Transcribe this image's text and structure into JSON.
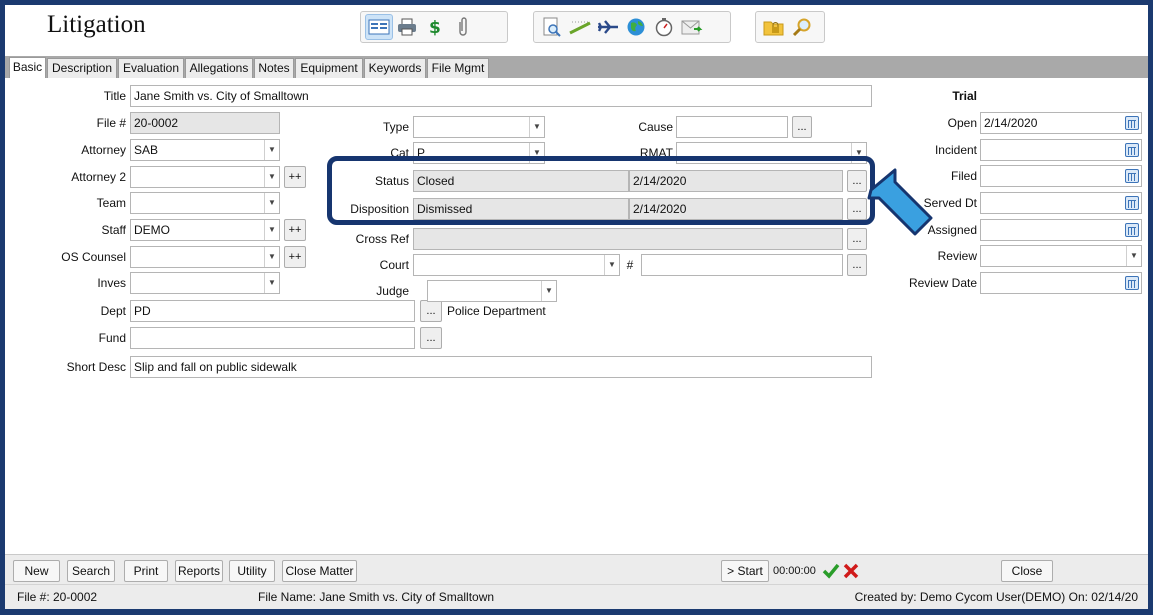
{
  "app": {
    "title": "Litigation"
  },
  "toolbar": {
    "group1": [
      "form-view-icon",
      "printer-icon",
      "money-icon",
      "paperclip-icon"
    ],
    "group2": [
      "document-search-icon",
      "pen-icon",
      "airplane-icon",
      "globe-icon",
      "stopwatch-icon",
      "email-icon"
    ],
    "group3": [
      "folder-lock-icon",
      "magnifier-icon"
    ]
  },
  "tabs": [
    "Basic",
    "Description",
    "Evaluation",
    "Allegations",
    "Notes",
    "Equipment",
    "Keywords",
    "File Mgmt"
  ],
  "form": {
    "title_label": "Title",
    "title_value": "Jane Smith vs. City of Smalltown",
    "file_label": "File #",
    "file_value": "20-0002",
    "attorney_label": "Attorney",
    "attorney_value": "SAB",
    "attorney2_label": "Attorney 2",
    "attorney2_value": "",
    "team_label": "Team",
    "team_value": "",
    "staff_label": "Staff",
    "staff_value": "DEMO",
    "os_counsel_label": "OS Counsel",
    "os_counsel_value": "",
    "inves_label": "Inves",
    "inves_value": "",
    "dept_label": "Dept",
    "dept_value": "PD",
    "dept_desc": "Police Department",
    "fund_label": "Fund",
    "fund_value": "",
    "short_desc_label": "Short Desc",
    "short_desc_value": "Slip and fall on public sidewalk",
    "type_label": "Type",
    "type_value": "",
    "cat_label": "Cat",
    "cat_value": "P",
    "status_label": "Status",
    "status_value": "Closed",
    "status_date": "2/14/2020",
    "disposition_label": "Disposition",
    "disposition_value": "Dismissed",
    "disposition_date": "2/14/2020",
    "cross_ref_label": "Cross Ref",
    "cross_ref_value": "",
    "court_label": "Court",
    "court_value": "",
    "court_num_label": "#",
    "court_num_value": "",
    "judge_label": "Judge",
    "judge_value": "",
    "cause_label": "Cause",
    "cause_value": "",
    "rmat_label": "RMAT",
    "rmat_value": "",
    "plus_label": "++",
    "ellipsis_label": "..."
  },
  "trial": {
    "heading": "Trial",
    "open_label": "Open",
    "open_value": "2/14/2020",
    "incident_label": "Incident",
    "incident_value": "",
    "filed_label": "Filed",
    "filed_value": "",
    "served_label": "Served Dt",
    "served_value": "",
    "assigned_label": "Assigned",
    "assigned_value": "",
    "review_label": "Review",
    "review_value": "",
    "review_date_label": "Review Date",
    "review_date_value": ""
  },
  "bottom": {
    "buttons": [
      "New",
      "Search",
      "Print",
      "Reports",
      "Utility",
      "Close Matter"
    ],
    "start_label": "> Start",
    "timer": "00:00:00",
    "close_label": "Close"
  },
  "status": {
    "file_no": "File #: 20-0002",
    "file_name": "File Name: Jane Smith vs. City of Smalltown",
    "created_by": "Created by: Demo Cycom User(DEMO) On: 02/14/20"
  },
  "colors": {
    "frame": "#1b3a70",
    "highlight": "#16356f",
    "arrow": "#3aa0e0",
    "tab_strip": "#a9a9a9",
    "ok": "#2a9d2a",
    "cancel": "#d01a1a"
  }
}
